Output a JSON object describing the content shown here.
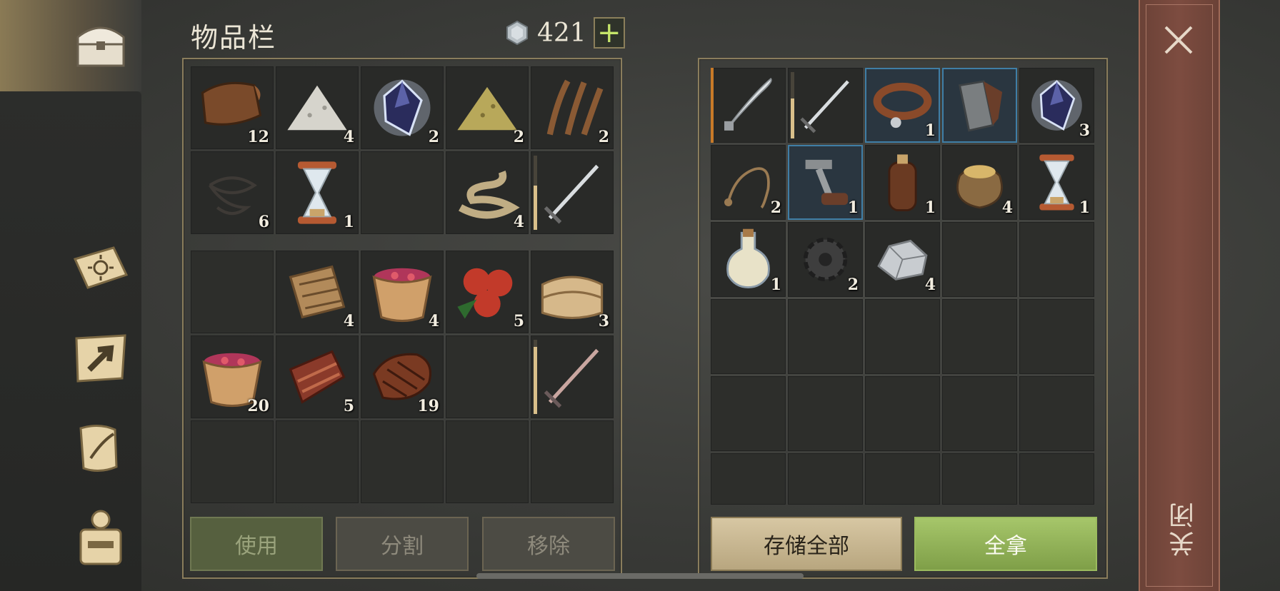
{
  "header": {
    "title": "物品栏",
    "currency": "421",
    "add_label": "+"
  },
  "nav": {
    "items": [
      "chest-icon",
      "sun-book-icon",
      "map-arrow-icon",
      "scroll-feather-icon",
      "backpack-icon"
    ]
  },
  "inventory": {
    "top": [
      {
        "icon": "leather",
        "count": "12"
      },
      {
        "icon": "powder-white",
        "count": "4"
      },
      {
        "icon": "crystal",
        "count": "2"
      },
      {
        "icon": "powder-yellow",
        "count": "2"
      },
      {
        "icon": "fiber",
        "count": "2"
      },
      {
        "icon": "wire",
        "count": "6"
      },
      {
        "icon": "hourglass",
        "count": "1"
      },
      {
        "icon": "",
        "count": ""
      },
      {
        "icon": "rope",
        "count": "4"
      },
      {
        "icon": "sword",
        "count": "",
        "durability": 0.6
      }
    ],
    "bottom": [
      {
        "icon": "",
        "count": ""
      },
      {
        "icon": "bark",
        "count": "4"
      },
      {
        "icon": "berry-bowl",
        "count": "4"
      },
      {
        "icon": "berries",
        "count": "5"
      },
      {
        "icon": "cloth",
        "count": "3"
      },
      {
        "icon": "berry-bowl",
        "count": "20"
      },
      {
        "icon": "meat-raw",
        "count": "5"
      },
      {
        "icon": "steak",
        "count": "19"
      },
      {
        "icon": "",
        "count": ""
      },
      {
        "icon": "sword-red",
        "count": "",
        "durability": 0.9
      },
      {
        "icon": "",
        "count": ""
      },
      {
        "icon": "",
        "count": ""
      },
      {
        "icon": "",
        "count": ""
      },
      {
        "icon": "",
        "count": ""
      },
      {
        "icon": "",
        "count": ""
      }
    ],
    "buttons": {
      "use": "使用",
      "split": "分割",
      "remove": "移除"
    }
  },
  "storage": {
    "items": [
      {
        "icon": "scimitar",
        "count": "",
        "quality": "orange"
      },
      {
        "icon": "sword",
        "count": "",
        "durability": 0.6
      },
      {
        "icon": "collar",
        "count": "1",
        "quality": "blue"
      },
      {
        "icon": "gauntlet",
        "count": "",
        "quality": "blue"
      },
      {
        "icon": "crystal",
        "count": "3"
      },
      {
        "icon": "whip",
        "count": "2"
      },
      {
        "icon": "crank",
        "count": "1",
        "quality": "blue"
      },
      {
        "icon": "flask",
        "count": "1"
      },
      {
        "icon": "sack",
        "count": "4"
      },
      {
        "icon": "hourglass",
        "count": "1"
      },
      {
        "icon": "potion",
        "count": "1"
      },
      {
        "icon": "gear",
        "count": "2"
      },
      {
        "icon": "stone",
        "count": "4"
      },
      {
        "icon": "",
        "count": ""
      },
      {
        "icon": "",
        "count": ""
      },
      {
        "icon": "",
        "count": ""
      },
      {
        "icon": "",
        "count": ""
      },
      {
        "icon": "",
        "count": ""
      },
      {
        "icon": "",
        "count": ""
      },
      {
        "icon": "",
        "count": ""
      },
      {
        "icon": "",
        "count": ""
      },
      {
        "icon": "",
        "count": ""
      },
      {
        "icon": "",
        "count": ""
      },
      {
        "icon": "",
        "count": ""
      },
      {
        "icon": "",
        "count": ""
      },
      {
        "icon": "",
        "count": ""
      },
      {
        "icon": "",
        "count": ""
      },
      {
        "icon": "",
        "count": ""
      },
      {
        "icon": "",
        "count": ""
      },
      {
        "icon": "",
        "count": ""
      }
    ],
    "buttons": {
      "store_all": "存储全部",
      "take_all": "全拿"
    }
  },
  "close": {
    "label": "关闭"
  },
  "colors": {
    "orange_quality": "#c87a28",
    "blue_quality": "#3f7ea6",
    "take_green": "#8fb055",
    "close_red": "#7d4c40"
  }
}
